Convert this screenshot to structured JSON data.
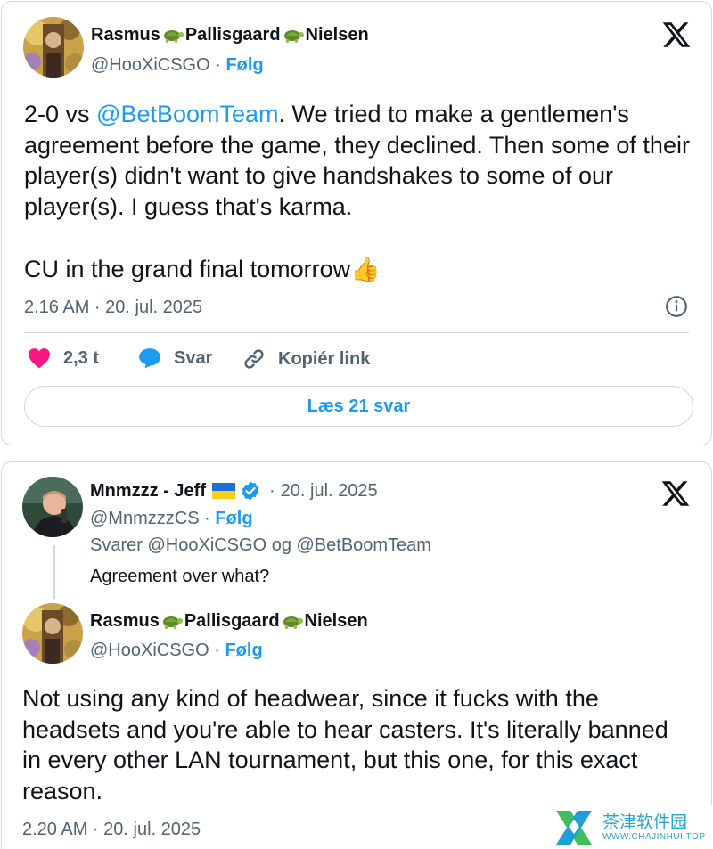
{
  "tweet1": {
    "author": {
      "name_parts": [
        "Rasmus",
        "Pallisgaard",
        "Nielsen"
      ],
      "name_emoji": "turtle",
      "handle": "@HooXiCSGO",
      "separator": "·",
      "follow_label": "Følg"
    },
    "text": {
      "pre": "2-0 vs ",
      "mention": "@BetBoomTeam",
      "post": ". We tried to make a gentlemen's agreement before the game, they declined. Then some of their player(s) didn't want to give handshakes to some of our player(s). I guess that's karma.",
      "line2": "CU in the grand final tomorrow",
      "emoji": "👍"
    },
    "timestamp": "2.16 AM · 20. jul. 2025",
    "actions": {
      "like_count": "2,3 t",
      "reply_label": "Svar",
      "copy_label": "Kopiér link"
    },
    "read_replies": "Læs 21 svar"
  },
  "tweet2": {
    "parent": {
      "name": "Mnmzzz - Jeff",
      "flag": "ukraine",
      "verified": true,
      "separator": "·",
      "date": "20. jul. 2025",
      "handle": "@MnmzzzCS",
      "follow_label": "Følg",
      "replying_to": "Svarer @HooXiCSGO og @BetBoomTeam",
      "text": "Agreement over what?"
    },
    "reply": {
      "name_parts": [
        "Rasmus",
        "Pallisgaard",
        "Nielsen"
      ],
      "handle": "@HooXiCSGO",
      "separator": "·",
      "follow_label": "Følg",
      "text": "Not using any kind of headwear, since it fucks with the headsets and you're able to hear casters. It's literally banned in every other LAN tournament, but this one, for this exact reason.",
      "timestamp": "2.20 AM · 20. jul. 2025"
    }
  },
  "watermark": {
    "text": "茶津软件园",
    "sub": "WWW.CHAJINHUI.TOP"
  },
  "colors": {
    "accent": "#1d9bf0",
    "secondary_text": "#536471",
    "border": "#cfd9de",
    "like": "#f91880"
  }
}
